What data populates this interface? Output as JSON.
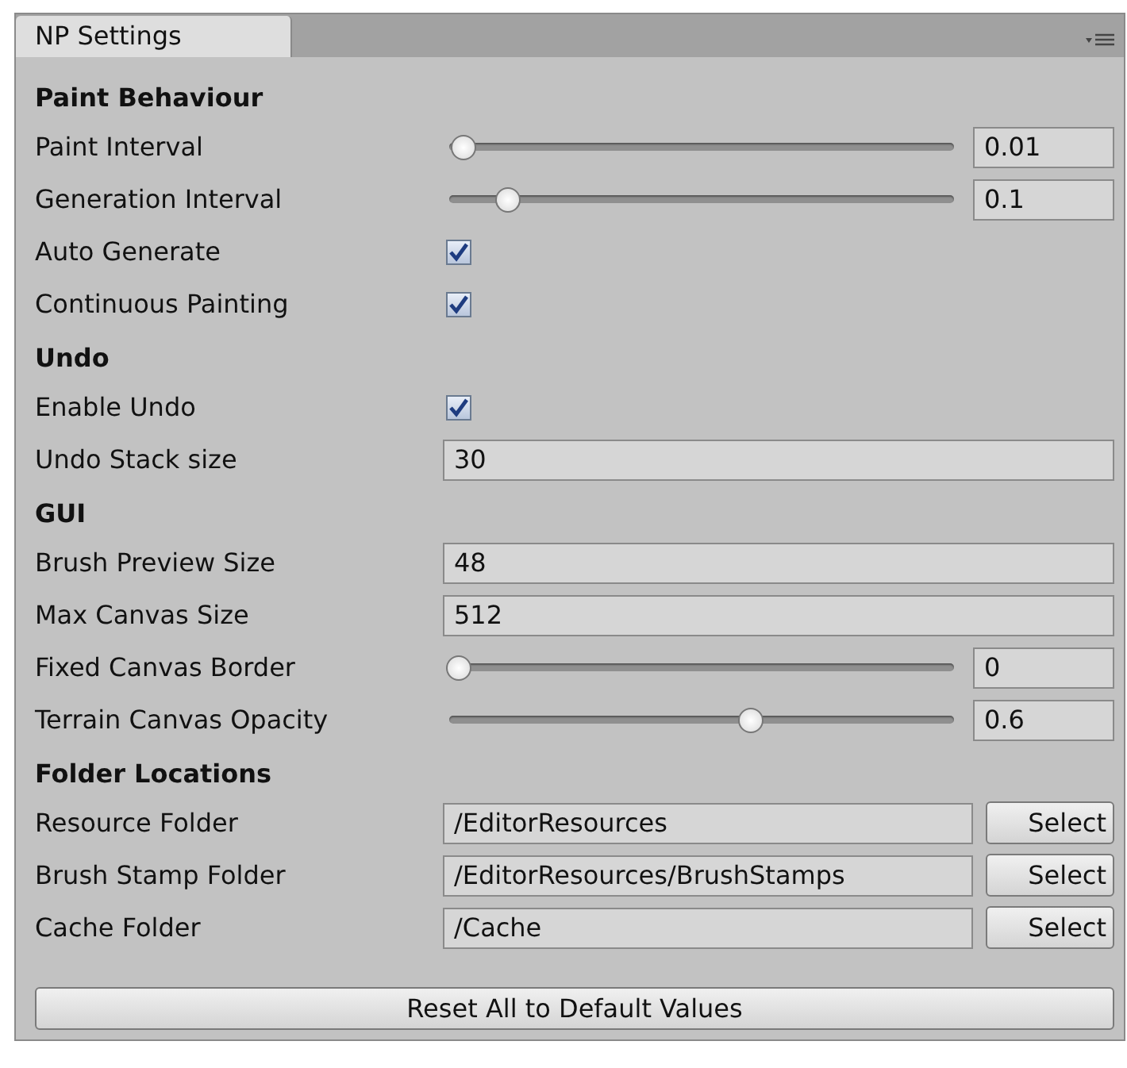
{
  "tab": {
    "label": "NP Settings",
    "selected": true
  },
  "sections": [
    {
      "title": "Paint Behaviour",
      "rows": [
        {
          "kind": "slider",
          "label": "Paint Interval",
          "level": 0.01,
          "value": "0.01"
        },
        {
          "kind": "slider",
          "label": "Generation Interval",
          "level": 0.1,
          "value": "0.1"
        },
        {
          "kind": "checkbox",
          "label": "Auto Generate",
          "checked": true
        },
        {
          "kind": "checkbox",
          "label": "Continuous Painting",
          "checked": true
        }
      ]
    },
    {
      "title": "Undo",
      "rows": [
        {
          "kind": "checkbox",
          "label": "Enable Undo",
          "checked": true
        },
        {
          "kind": "text",
          "label": "Undo Stack size",
          "value": "30"
        }
      ]
    },
    {
      "title": "GUI",
      "rows": [
        {
          "kind": "text",
          "label": "Brush Preview Size",
          "value": "48"
        },
        {
          "kind": "text",
          "label": "Max Canvas Size",
          "value": "512"
        },
        {
          "kind": "slider",
          "label": "Fixed Canvas Border",
          "level": 0,
          "value": "0"
        },
        {
          "kind": "slider",
          "label": "Terrain Canvas Opacity",
          "level": 0.6,
          "value": "0.6"
        }
      ]
    },
    {
      "title": "Folder Locations",
      "rows": [
        {
          "kind": "folder",
          "label": "Resource Folder",
          "value": "/EditorResources",
          "button": "Select"
        },
        {
          "kind": "folder",
          "label": "Brush Stamp Folder",
          "value": "/EditorResources/BrushStamps",
          "button": "Select"
        },
        {
          "kind": "folder",
          "label": "Cache Folder",
          "value": "/Cache",
          "button": "Select"
        }
      ]
    }
  ],
  "reset_button": "Reset All to Default Values"
}
